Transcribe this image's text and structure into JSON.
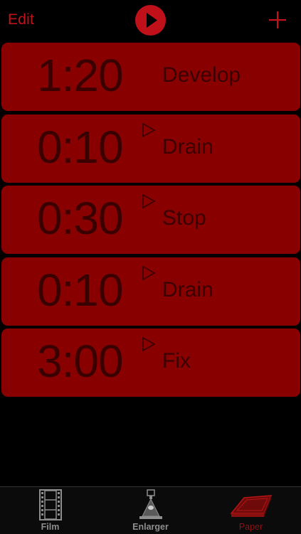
{
  "nav": {
    "edit_label": "Edit",
    "play_icon": "play-icon",
    "add_icon": "plus-icon"
  },
  "colors": {
    "accent": "#c4111b",
    "card_background": "#880000",
    "card_text": "#3a0000",
    "tab_inactive": "#8e8e8e",
    "tab_active": "#8a1515"
  },
  "steps": [
    {
      "time": "1:20",
      "name": "Develop",
      "has_play_indicator": false
    },
    {
      "time": "0:10",
      "name": "Drain",
      "has_play_indicator": true
    },
    {
      "time": "0:30",
      "name": "Stop",
      "has_play_indicator": true
    },
    {
      "time": "0:10",
      "name": "Drain",
      "has_play_indicator": true
    },
    {
      "time": "3:00",
      "name": "Fix",
      "has_play_indicator": true
    }
  ],
  "tabs": [
    {
      "label": "Film",
      "icon": "film-strip-icon",
      "selected": false
    },
    {
      "label": "Enlarger",
      "icon": "enlarger-icon",
      "selected": false
    },
    {
      "label": "Paper",
      "icon": "paper-tray-icon",
      "selected": true
    }
  ]
}
